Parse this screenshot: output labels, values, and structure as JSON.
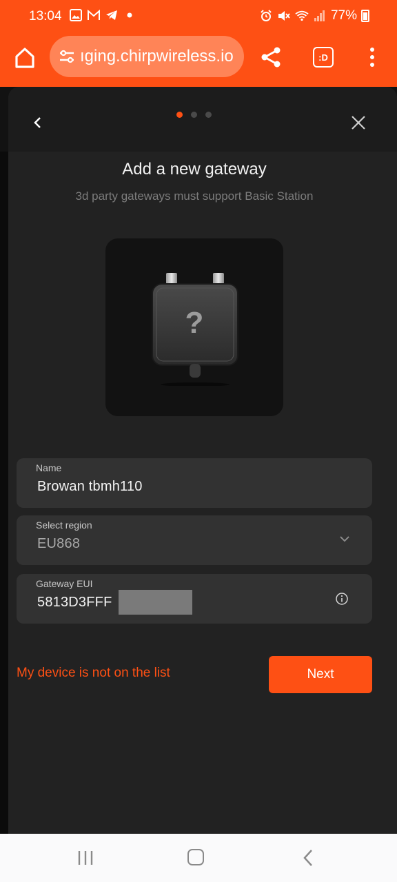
{
  "status_bar": {
    "time": "13:04",
    "battery": "77%"
  },
  "browser": {
    "url": "ıging.chirpwireless.io",
    "tabs_label": ":D"
  },
  "modal": {
    "step_count": 3,
    "active_step": 1,
    "title": "Add a new gateway",
    "subtitle": "3d party gateways must support Basic Station",
    "device_image_glyph": "?",
    "fields": {
      "name": {
        "label": "Name",
        "value": "Browan tbmh110"
      },
      "region": {
        "label": "Select region",
        "value": "EU868"
      },
      "eui": {
        "label": "Gateway EUI",
        "value": "5813D3FFF"
      }
    },
    "not_on_list_link": "My device is not on the list",
    "next_button": "Next"
  },
  "colors": {
    "accent": "#fe5014",
    "sheet": "#222222",
    "field": "#323232"
  },
  "icons": [
    "home-icon",
    "tune-icon",
    "share-icon",
    "more-vert-icon",
    "chevron-left-icon",
    "close-icon",
    "chevron-down-icon",
    "info-icon",
    "nav-recent-icon",
    "nav-home-icon",
    "nav-back-icon"
  ]
}
